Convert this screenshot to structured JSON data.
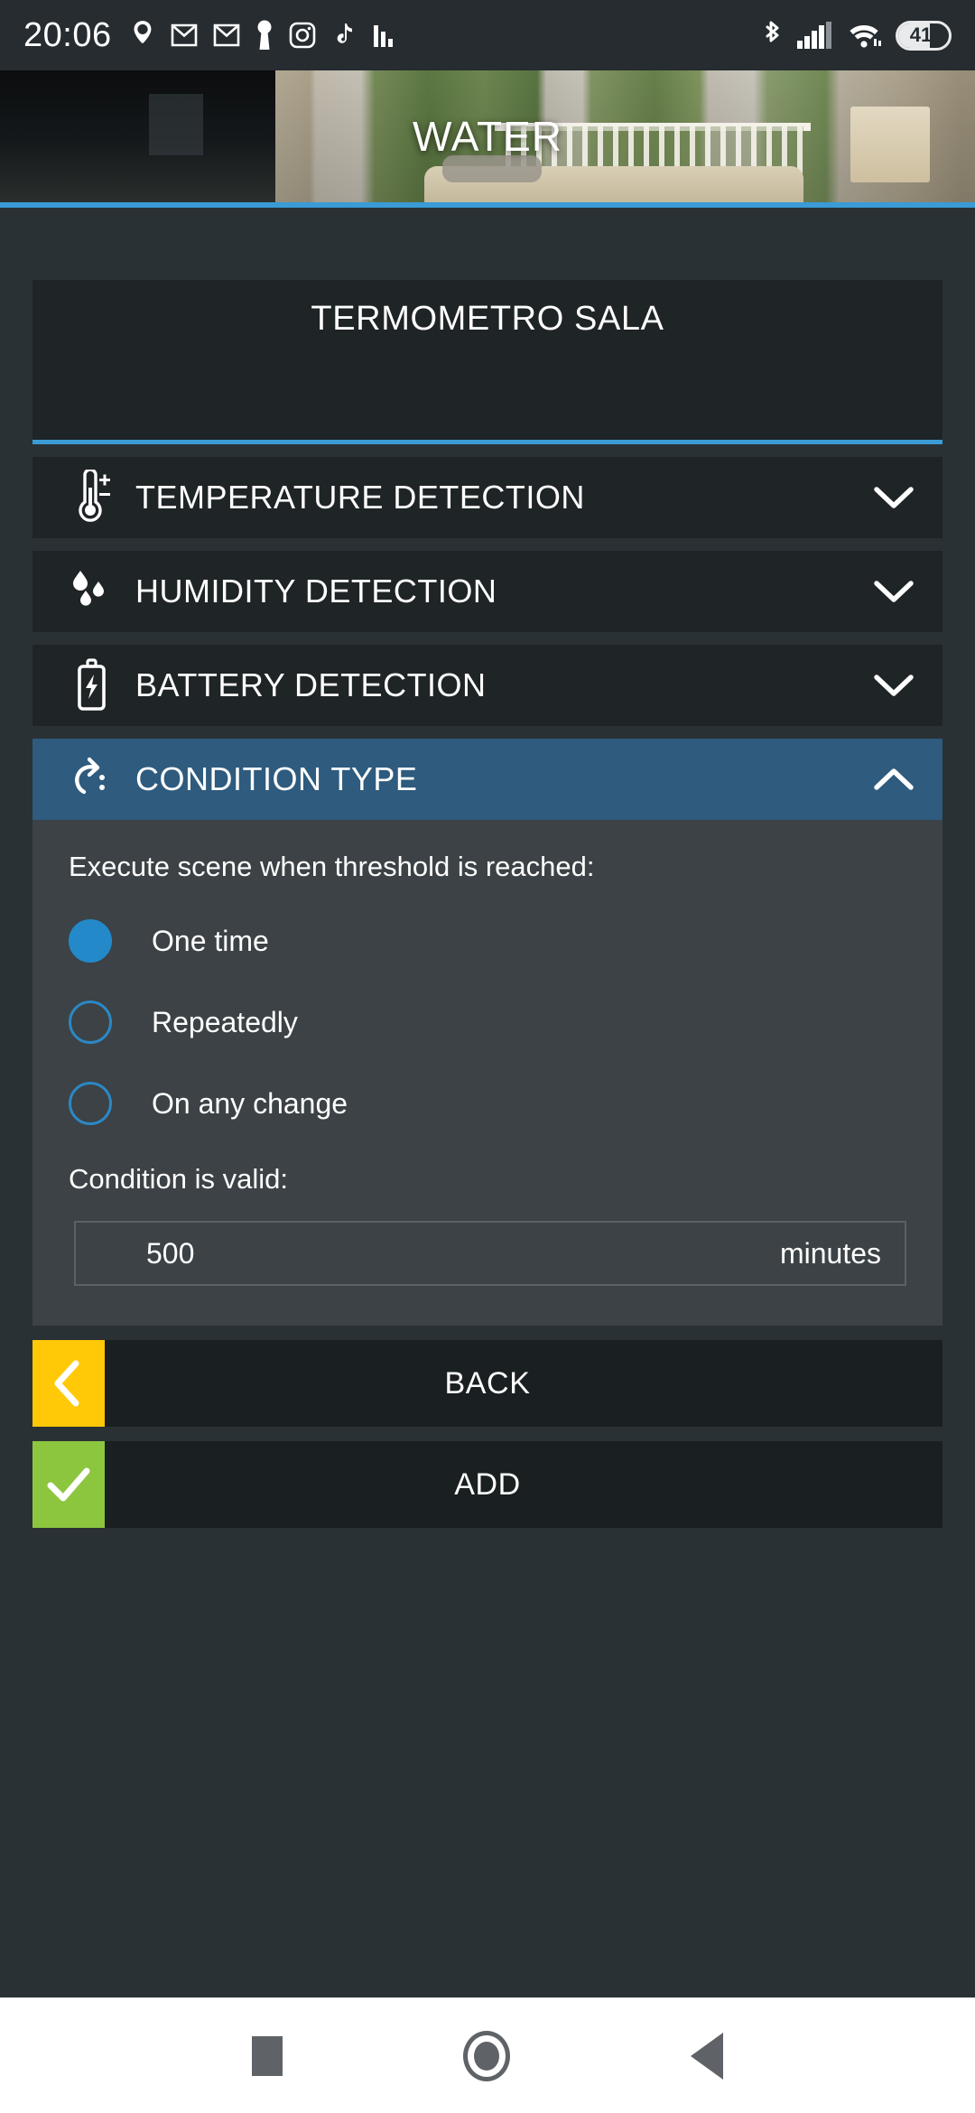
{
  "statusbar": {
    "time": "20:06",
    "left_icons": [
      "location-icon",
      "gmail-icon",
      "gmail-icon",
      "keyhole-icon",
      "instagram-icon",
      "tiktok-icon",
      "bar-chart-icon"
    ],
    "right_icons": [
      "bluetooth-icon",
      "cellular-signal-icon",
      "wifi-icon"
    ],
    "battery_level": "41"
  },
  "header": {
    "title": "WATER",
    "accent_color": "#3a9bd6"
  },
  "device": {
    "name": "TERMOMETRO SALA"
  },
  "sections": [
    {
      "icon": "thermometer-icon",
      "label": "TEMPERATURE DETECTION",
      "expanded": false,
      "chevron": "chevron-down-icon"
    },
    {
      "icon": "water-drops-icon",
      "label": "HUMIDITY DETECTION",
      "expanded": false,
      "chevron": "chevron-down-icon"
    },
    {
      "icon": "battery-bolt-icon",
      "label": "BATTERY DETECTION",
      "expanded": false,
      "chevron": "chevron-down-icon"
    },
    {
      "icon": "refresh-icon",
      "label": "CONDITION TYPE",
      "expanded": true,
      "chevron": "chevron-up-icon"
    }
  ],
  "condition_panel": {
    "prompt": "Execute scene when threshold is reached:",
    "options": [
      {
        "label": "One time",
        "selected": true
      },
      {
        "label": "Repeatedly",
        "selected": false
      },
      {
        "label": "On any change",
        "selected": false
      }
    ],
    "valid_label": "Condition is valid:",
    "duration_value": "500",
    "duration_unit": "minutes",
    "selected_color": "#2389c9",
    "panel_color": "#3c4245"
  },
  "actions": [
    {
      "label": "BACK",
      "icon": "chevron-left-icon",
      "color": "#ffc907"
    },
    {
      "label": "ADD",
      "icon": "check-icon",
      "color": "#8cc63f"
    }
  ],
  "navbar": {
    "recents": "square-icon",
    "home": "circle-icon",
    "back": "triangle-back-icon"
  }
}
